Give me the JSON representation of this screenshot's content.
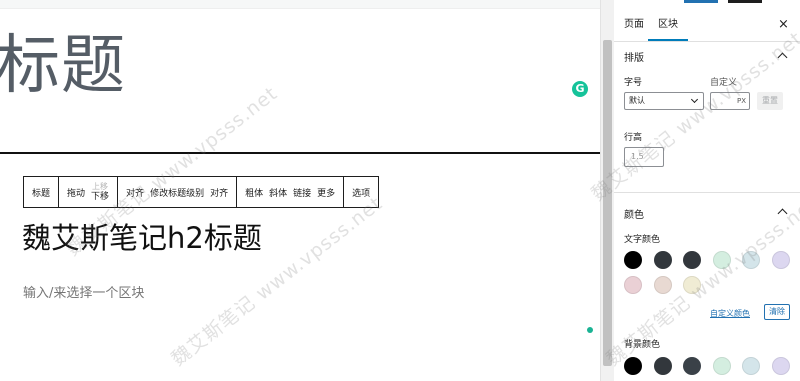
{
  "editor": {
    "title": "标题",
    "h2_heading": "魏艾斯笔记h2标题",
    "appender_placeholder": "输入/来选择一个区块",
    "toolbar": {
      "heading": "标题",
      "drag": "拖动",
      "move_up": "上移",
      "move_down": "下移",
      "align": "对齐",
      "change_level": "修改标题级别",
      "text_align": "对齐",
      "bold": "粗体",
      "italic": "斜体",
      "link": "链接",
      "more": "更多",
      "options": "选项"
    }
  },
  "sidebar": {
    "tabs": [
      "页面",
      "区块"
    ],
    "active_tab": "区块",
    "close": "×",
    "typography": {
      "title": "排版",
      "font_size_label": "字号",
      "custom_label": "自定义",
      "font_size_value": "默认",
      "custom_unit": "PX",
      "reset": "重置",
      "line_height_label": "行高",
      "line_height_placeholder": "1.5"
    },
    "color": {
      "title": "颜色",
      "text_color_label": "文字颜色",
      "background_color_label": "背景颜色",
      "custom_color": "自定义颜色",
      "clear": "清除",
      "text_swatches": [
        "#000000",
        "#32373c",
        "#32373c",
        "#d4eee0",
        "#d4e5ea",
        "#dcd7f0",
        "#ead0d5",
        "#e8d9d2",
        "#f0ecd4"
      ],
      "background_swatches": [
        "#000000",
        "#32373c",
        "#3a4148",
        "#d4eee0",
        "#d4e5ea",
        "#dcd7f0"
      ]
    }
  },
  "watermark": "魏艾斯笔记 www.vpsss.net",
  "colors": {
    "accent": "#007cba",
    "link": "#2271b1",
    "grammarly": "#15c39a"
  }
}
